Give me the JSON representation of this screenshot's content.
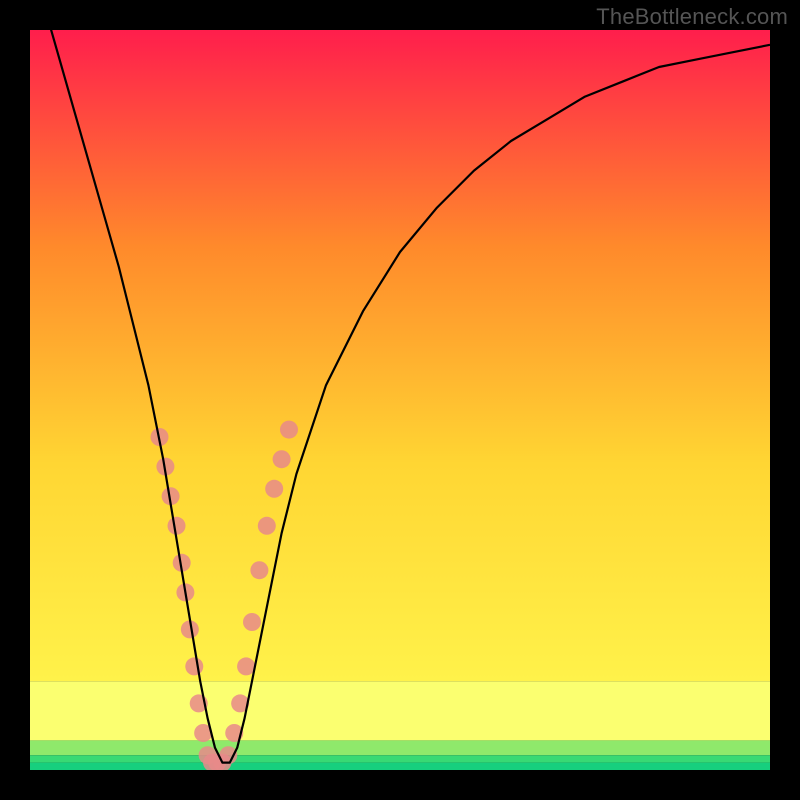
{
  "watermark": "TheBottleneck.com",
  "chart_data": {
    "type": "line",
    "title": "",
    "xlabel": "",
    "ylabel": "",
    "xlim": [
      0,
      100
    ],
    "ylim": [
      0,
      100
    ],
    "series": [
      {
        "name": "bottleneck-curve",
        "x": [
          0,
          2,
          4,
          6,
          8,
          10,
          12,
          14,
          16,
          18,
          20,
          21,
          22,
          23,
          24,
          25,
          26,
          27,
          28,
          29,
          30,
          32,
          34,
          36,
          40,
          45,
          50,
          55,
          60,
          65,
          70,
          75,
          80,
          85,
          90,
          95,
          100
        ],
        "y": [
          110,
          103,
          96,
          89,
          82,
          75,
          68,
          60,
          52,
          42,
          30,
          24,
          18,
          12,
          7,
          3,
          1,
          1,
          3,
          7,
          12,
          22,
          32,
          40,
          52,
          62,
          70,
          76,
          81,
          85,
          88,
          91,
          93,
          95,
          96,
          97,
          98
        ],
        "color": "#000000"
      }
    ],
    "gradient_bands": [
      {
        "y_from": 100,
        "y_to": 12,
        "colors": [
          "#ff1e4c",
          "#ff8a2b",
          "#ffd633",
          "#fff24a"
        ]
      },
      {
        "y_from": 12,
        "y_to": 4,
        "color": "#fbff70"
      },
      {
        "y_from": 4,
        "y_to": 2,
        "color": "#8fe96b"
      },
      {
        "y_from": 2,
        "y_to": 1,
        "color": "#38d974"
      },
      {
        "y_from": 1,
        "y_to": 0,
        "color": "#17cf7e"
      }
    ],
    "highlight_points": {
      "color": "#e88a8a",
      "points_x": [
        17.5,
        18.3,
        19.0,
        19.8,
        20.5,
        21.0,
        21.6,
        22.2,
        22.8,
        23.4,
        24.0,
        24.6,
        25.3,
        26.0,
        26.8,
        27.6,
        28.4,
        29.2,
        30.0,
        31.0,
        32.0,
        33.0,
        34.0,
        35.0
      ],
      "points_y": [
        45,
        41,
        37,
        33,
        28,
        24,
        19,
        14,
        9,
        5,
        2,
        1,
        1,
        1,
        2,
        5,
        9,
        14,
        20,
        27,
        33,
        38,
        42,
        46
      ]
    }
  }
}
